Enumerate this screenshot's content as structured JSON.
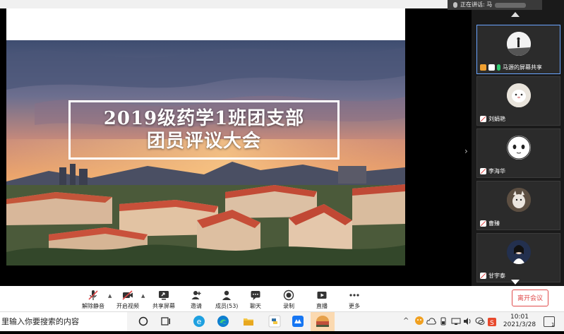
{
  "slide": {
    "title_line1": "2019级药学1班团支部",
    "title_line2": "团员评议大会"
  },
  "speaking": {
    "label": "正在讲话: 马"
  },
  "participants": [
    {
      "name": "马源的屏幕共享",
      "active": true
    },
    {
      "name": "刘娟艳",
      "active": false
    },
    {
      "name": "李海华",
      "active": false
    },
    {
      "name": "曹臻",
      "active": false
    },
    {
      "name": "甘宇泰",
      "active": false
    }
  ],
  "toolbar": {
    "mute_label": "解除静音",
    "video_label": "开启视频",
    "share_label": "共享屏幕",
    "invite_label": "邀请",
    "members_label": "成员(53)",
    "chat_label": "聊天",
    "record_label": "录制",
    "live_label": "直播",
    "more_label": "更多",
    "leave_label": "离开会议"
  },
  "taskbar": {
    "search_placeholder": "里输入你要搜索的内容",
    "time": "10:01",
    "date": "2021/3/28",
    "notification_count": "1"
  },
  "colors": {
    "leave_red": "#e04a4a",
    "active_tile_border": "#6aa5ff",
    "gallery_bg": "#1a1a1a"
  }
}
